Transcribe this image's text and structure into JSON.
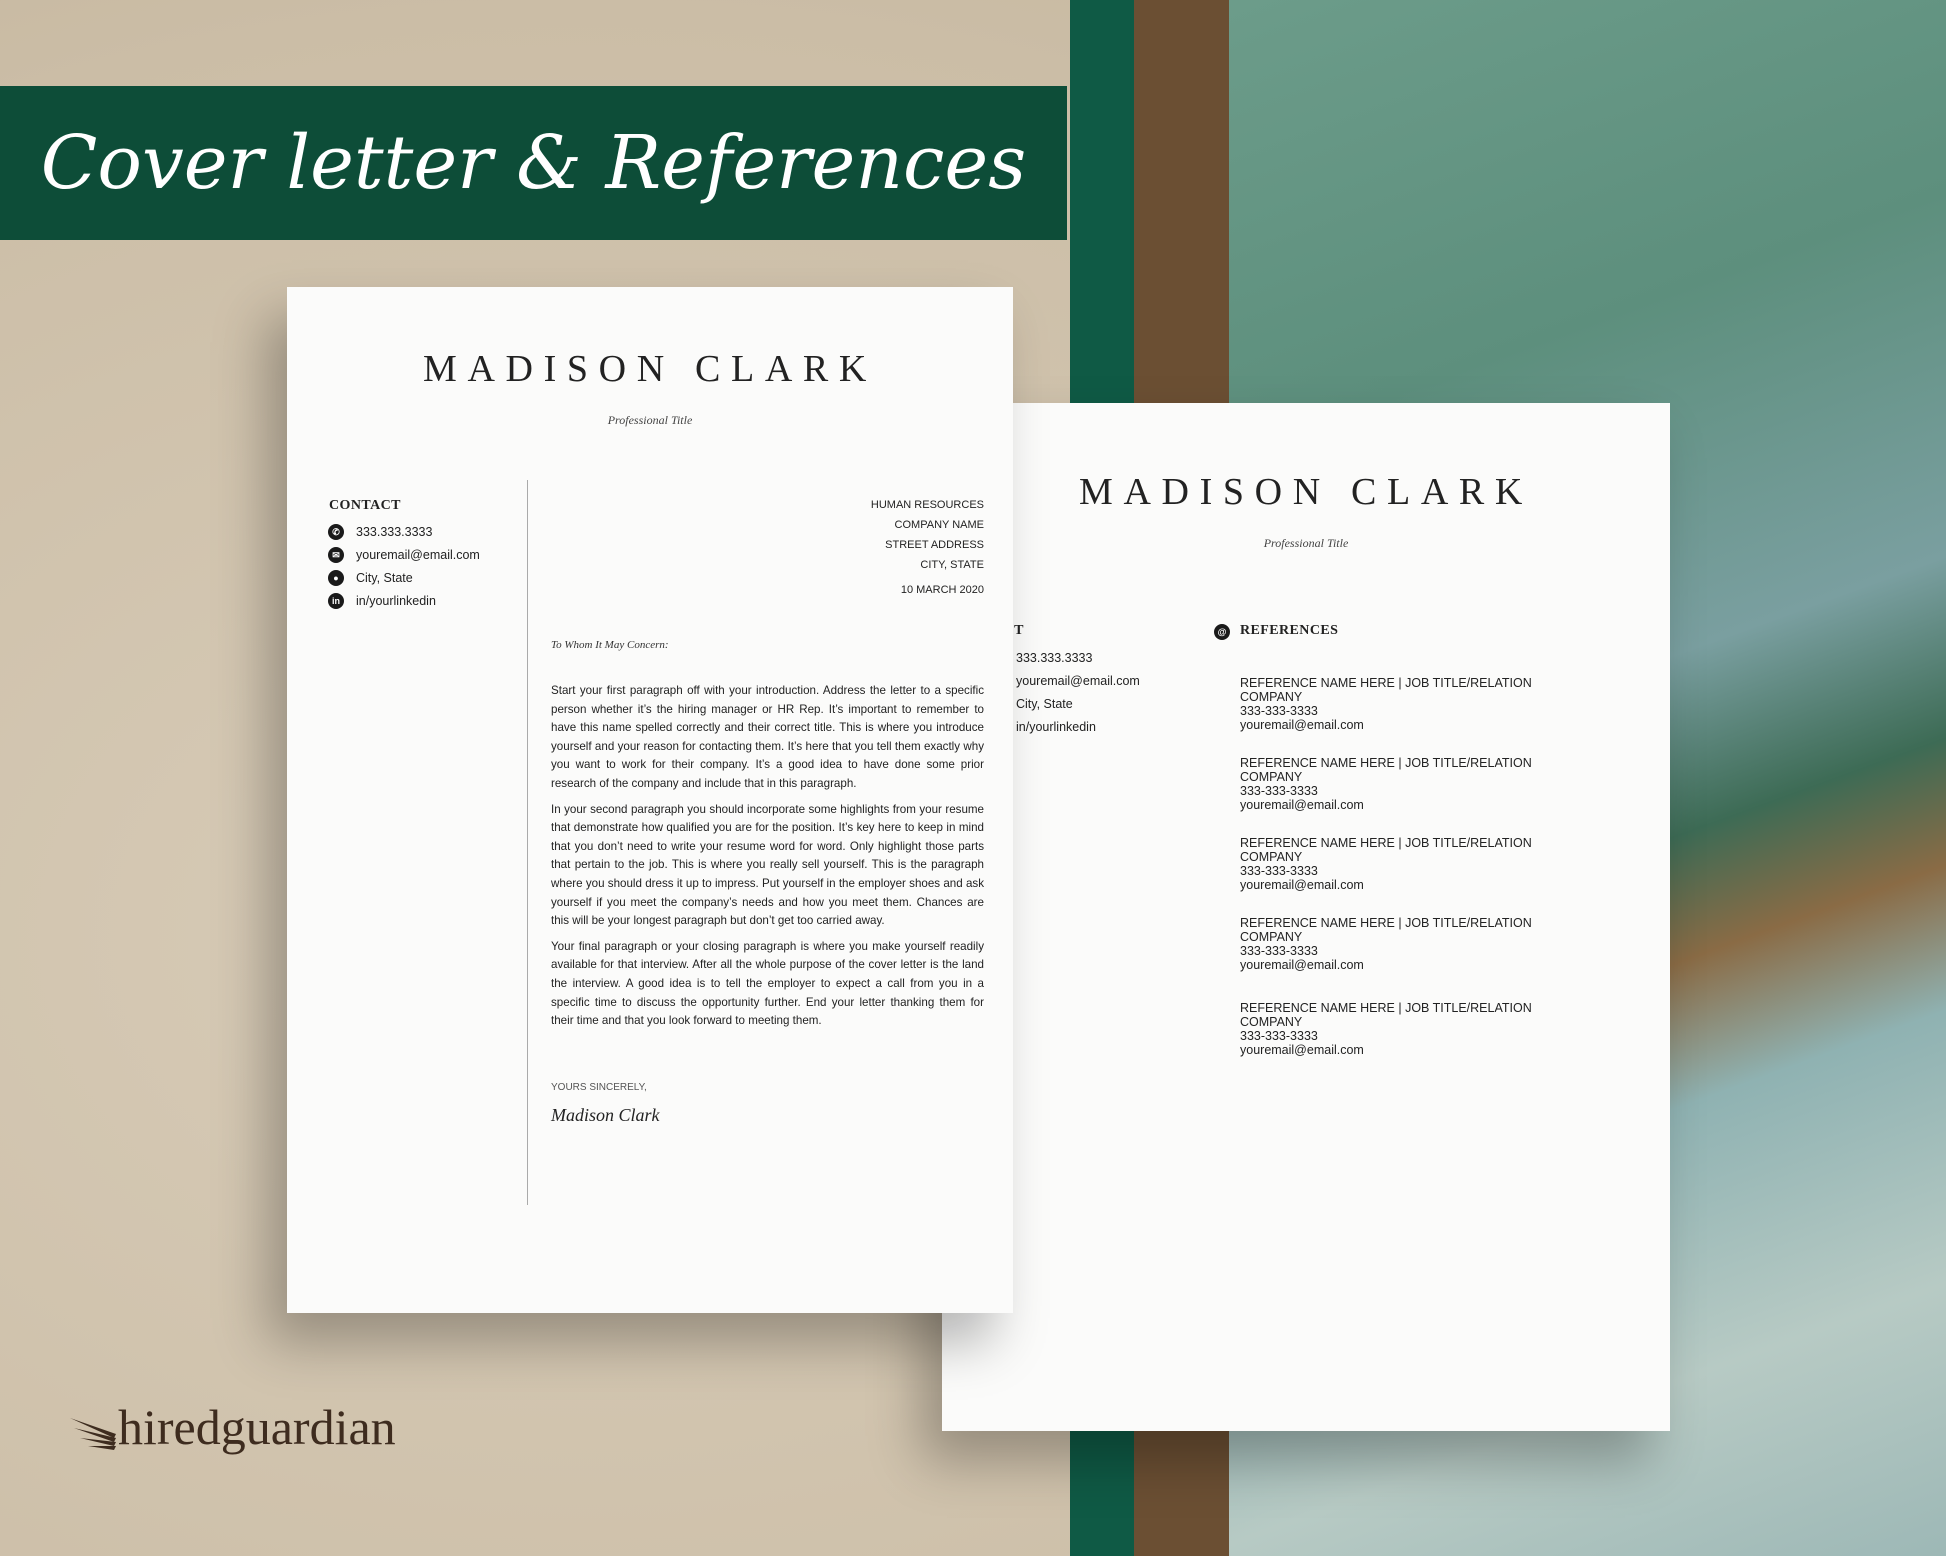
{
  "banner": {
    "title": "Cover letter & References"
  },
  "cover_letter": {
    "name": "MADISON CLARK",
    "professional_title": "Professional Title",
    "contact_heading": "CONTACT",
    "contact": [
      {
        "icon": "phone-icon",
        "text": "333.333.3333"
      },
      {
        "icon": "email-icon",
        "text": "youremail@email.com"
      },
      {
        "icon": "location-icon",
        "text": "City, State"
      },
      {
        "icon": "linkedin-icon",
        "text": "in/yourlinkedin"
      }
    ],
    "recipient": [
      "HUMAN RESOURCES",
      "COMPANY NAME",
      "STREET ADDRESS",
      "CITY, STATE"
    ],
    "date": "10 MARCH 2020",
    "greeting": "To Whom It May Concern:",
    "paragraphs": [
      "Start your first paragraph off with your introduction. Address the letter to a specific person whether it’s the hiring manager or HR Rep. It’s important to remember to have this name spelled correctly and their correct title. This is where you introduce yourself and your reason for contacting them. It’s here that you tell them exactly why you want to work for their company. It’s a good idea to have done some prior research of the company and include that in this paragraph.",
      "In your second paragraph you should incorporate some highlights from your resume that demonstrate how qualified you are for the position. It’s key here to keep in mind that you don’t need to write your resume word for word. Only highlight those parts that pertain to the job. This is where you really sell yourself. This is the paragraph where you should dress it up to impress. Put yourself in the employer shoes and ask yourself if you meet the company’s needs and how you meet them. Chances are this will be your longest paragraph but don’t get too carried away.",
      "Your final paragraph or your closing paragraph is where you make yourself readily available for that interview. After all the whole purpose of the cover letter is the land the interview. A good idea is to tell the employer to expect a call from you in a specific time to discuss the opportunity further. End your letter thanking them for their time and that you look forward to meeting them."
    ],
    "closing": "YOURS SINCERELY,",
    "signature": "Madison Clark"
  },
  "references_page": {
    "name": "MADISON CLARK",
    "professional_title": "Professional Title",
    "contact_heading": "CONTACT",
    "contact": [
      "333.333.3333",
      "youremail@email.com",
      "City, State",
      "in/yourlinkedin"
    ],
    "references_heading": "REFERENCES",
    "references_icon": "at-icon",
    "references": [
      {
        "name": "REFERENCE NAME HERE | JOB TITLE/RELATION",
        "company": "COMPANY",
        "phone": "333-333-3333",
        "email": "youremail@email.com"
      },
      {
        "name": "REFERENCE NAME HERE | JOB TITLE/RELATION",
        "company": "COMPANY",
        "phone": "333-333-3333",
        "email": "youremail@email.com"
      },
      {
        "name": "REFERENCE NAME HERE | JOB TITLE/RELATION",
        "company": "COMPANY",
        "phone": "333-333-3333",
        "email": "youremail@email.com"
      },
      {
        "name": "REFERENCE NAME HERE | JOB TITLE/RELATION",
        "company": "COMPANY",
        "phone": "333-333-3333",
        "email": "youremail@email.com"
      },
      {
        "name": "REFERENCE NAME HERE | JOB TITLE/RELATION",
        "company": "COMPANY",
        "phone": "333-333-3333",
        "email": "youremail@email.com"
      }
    ]
  },
  "logo": {
    "text": "hiredguardian"
  },
  "colors": {
    "banner": "#0d4d38",
    "background": "#d8ccb8",
    "logo": "#3e2c1f"
  }
}
